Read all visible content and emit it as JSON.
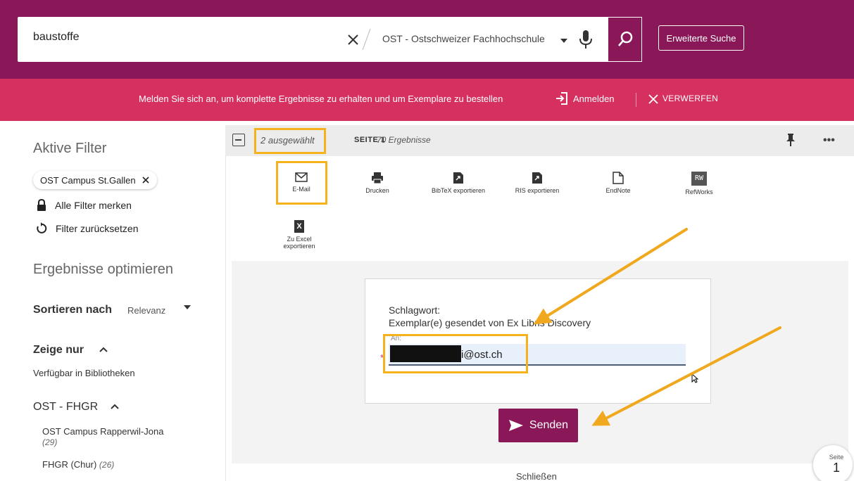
{
  "search": {
    "query": "baustoffe",
    "scope": "OST - Ostschweizer Fachhochschule",
    "advanced_label": "Erweiterte Suche"
  },
  "banner": {
    "message": "Melden Sie sich an, um komplette Ergebnisse zu erhalten und um Exemplare zu bestellen",
    "login_label": "Anmelden",
    "dismiss_label": "VERWERFEN"
  },
  "sidebar": {
    "active_filters_title": "Aktive Filter",
    "active_filter_chip": "OST Campus St.Gallen",
    "remember_filters": "Alle Filter merken",
    "reset_filters": "Filter zurücksetzen",
    "optimize_title": "Ergebnisse optimieren",
    "sort_label": "Sortieren nach",
    "sort_value": "Relevanz",
    "show_only_label": "Zeige nur",
    "available_in_libraries": "Verfügbar in Bibliotheken",
    "group_title": "OST - FHGR",
    "campus_rapperswil": "OST Campus Rapperwil-Jona",
    "campus_rapperswil_count": "(29)",
    "fhgr_chur": "FHGR (Chur)",
    "fhgr_chur_count": "(26)"
  },
  "results": {
    "selected": "2 ausgewählt",
    "page_label": "SEITE 1",
    "count": "70 Ergebnisse"
  },
  "actions": [
    {
      "label": "E-Mail",
      "icon": "envelope-icon"
    },
    {
      "label": "Drucken",
      "icon": "printer-icon"
    },
    {
      "label": "BibTeX exportieren",
      "icon": "export-icon"
    },
    {
      "label": "RIS exportieren",
      "icon": "export-icon"
    },
    {
      "label": "EndNote",
      "icon": "document-icon"
    },
    {
      "label": "RefWorks",
      "icon": "refworks-icon"
    },
    {
      "label": "Zu Excel exportieren",
      "icon": "excel-icon"
    }
  ],
  "refworks_glyph": "RW",
  "excel_glyph": "X",
  "form": {
    "subject_label": "Schlagwort:",
    "subject_value": "Exemplar(e) gesendet von Ex Libris Discovery",
    "to_label": "An:",
    "to_value": "i@ost.ch",
    "required_mark": "*"
  },
  "send_label": "Senden",
  "close_label": "Schließen",
  "page_badge": {
    "label": "Seite",
    "number": "1"
  },
  "colors": {
    "header": "#8a1858",
    "banner": "#d6315e",
    "highlight": "#f5b21c",
    "arrow": "#f0a81e"
  }
}
